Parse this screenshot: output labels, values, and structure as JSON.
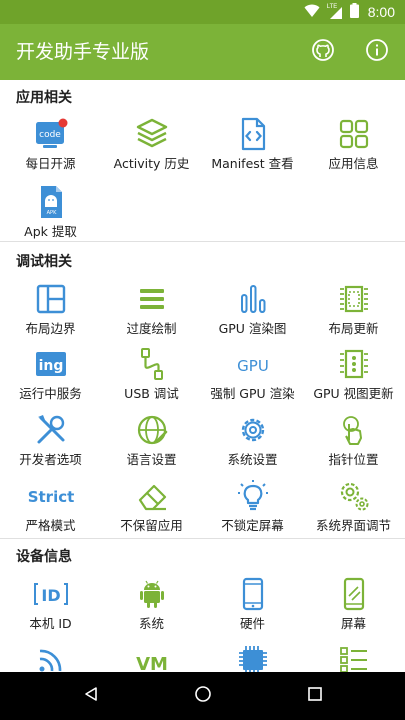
{
  "status_bar": {
    "time": "8:00",
    "network_label": "LTE"
  },
  "app_bar": {
    "title": "开发助手专业版",
    "github_icon": "github-icon",
    "info_icon": "info-icon"
  },
  "colors": {
    "primary": "#7cb338",
    "status_bar": "#6fa32a",
    "accent_icon": "#3d8fd6",
    "green_icon": "#7cb338",
    "badge": "#e53935"
  },
  "sections": [
    {
      "title": "应用相关",
      "items": [
        {
          "label": "每日开源",
          "icon": "code-badge-icon"
        },
        {
          "label": "Activity 历史",
          "icon": "layers-icon"
        },
        {
          "label": "Manifest 查看",
          "icon": "file-code-icon"
        },
        {
          "label": "应用信息",
          "icon": "grid-icon"
        },
        {
          "label": "Apk 提取",
          "icon": "apk-file-icon"
        }
      ]
    },
    {
      "title": "调试相关",
      "items": [
        {
          "label": "布局边界",
          "icon": "layout-bounds-icon"
        },
        {
          "label": "过度绘制",
          "icon": "overdraw-icon"
        },
        {
          "label": "GPU 渲染图",
          "icon": "gpu-bars-icon"
        },
        {
          "label": "布局更新",
          "icon": "layout-update-icon"
        },
        {
          "label": "运行中服务",
          "icon": "ing-icon",
          "icon_text": "ing"
        },
        {
          "label": "USB 调试",
          "icon": "usb-icon"
        },
        {
          "label": "强制 GPU 渲染",
          "icon": "gpu-text-icon",
          "icon_text": "GPU"
        },
        {
          "label": "GPU 视图更新",
          "icon": "gpu-view-update-icon"
        },
        {
          "label": "开发者选项",
          "icon": "tools-icon"
        },
        {
          "label": "语言设置",
          "icon": "language-globe-icon"
        },
        {
          "label": "系统设置",
          "icon": "settings-gear-icon"
        },
        {
          "label": "指针位置",
          "icon": "pointer-touch-icon"
        },
        {
          "label": "严格模式",
          "icon": "strict-text-icon",
          "icon_text": "Strict"
        },
        {
          "label": "不保留应用",
          "icon": "eraser-icon"
        },
        {
          "label": "不锁定屏幕",
          "icon": "bulb-icon"
        },
        {
          "label": "系统界面调节",
          "icon": "gears-icon"
        }
      ]
    },
    {
      "title": "设备信息",
      "items": [
        {
          "label": "本机 ID",
          "icon": "id-icon",
          "icon_text": "ID"
        },
        {
          "label": "系统",
          "icon": "android-icon"
        },
        {
          "label": "硬件",
          "icon": "phone-icon"
        },
        {
          "label": "屏幕",
          "icon": "screen-icon"
        },
        {
          "label": "",
          "icon": "wifi-icon"
        },
        {
          "label": "",
          "icon": "vm-icon",
          "icon_text": "VM"
        },
        {
          "label": "",
          "icon": "cpu-icon"
        },
        {
          "label": "",
          "icon": "list-icon"
        }
      ]
    }
  ],
  "nav_bar": {
    "back": "back-icon",
    "home": "home-icon",
    "recent": "recent-apps-icon"
  }
}
